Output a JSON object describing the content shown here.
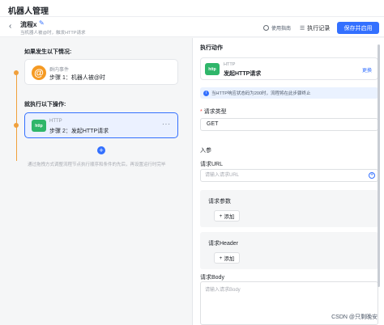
{
  "app": {
    "title": "机器人管理"
  },
  "header": {
    "back_icon": "chevron-left-icon",
    "flow_name": "流程x",
    "flow_desc": "当机器人被@时，触发HTTP请求",
    "guide_label": "使用指南",
    "log_label": "执行记录",
    "save_label": "保存并启用"
  },
  "canvas": {
    "trigger_section": "如果发生以下情况:",
    "trigger_card": {
      "type": "群内事件",
      "step": "步骤 1：机器人被@时"
    },
    "action_section": "就执行以下操作:",
    "action_card": {
      "type": "HTTP",
      "step": "步骤 2：发起HTTP请求",
      "more": "···"
    },
    "add_label": "+",
    "hint": "通过拖拽方式调整流程节点执行顺序和条件的先后，再设置运行时完毕"
  },
  "panel": {
    "title": "执行动作",
    "action": {
      "type": "HTTP",
      "name": "发起HTTP请求",
      "change_label": "更换",
      "icon_text": "http"
    },
    "notice": "当HTTP响应状态码为200时，流程将在此步骤终止",
    "method": {
      "label": "请求类型",
      "value": "GET"
    },
    "input_section": "入参",
    "url": {
      "label": "请求URL",
      "placeholder": "请输入请求URL"
    },
    "params": {
      "label": "请求参数",
      "add_label": "添加"
    },
    "headers": {
      "label": "请求Header",
      "add_label": "添加"
    },
    "body": {
      "label": "请求Body",
      "placeholder": "请输入请求Body"
    }
  },
  "watermark": "CSDN @只剩晚安",
  "colors": {
    "accent": "#3370ff",
    "trigger": "#f59a23",
    "http": "#2fb66a"
  }
}
